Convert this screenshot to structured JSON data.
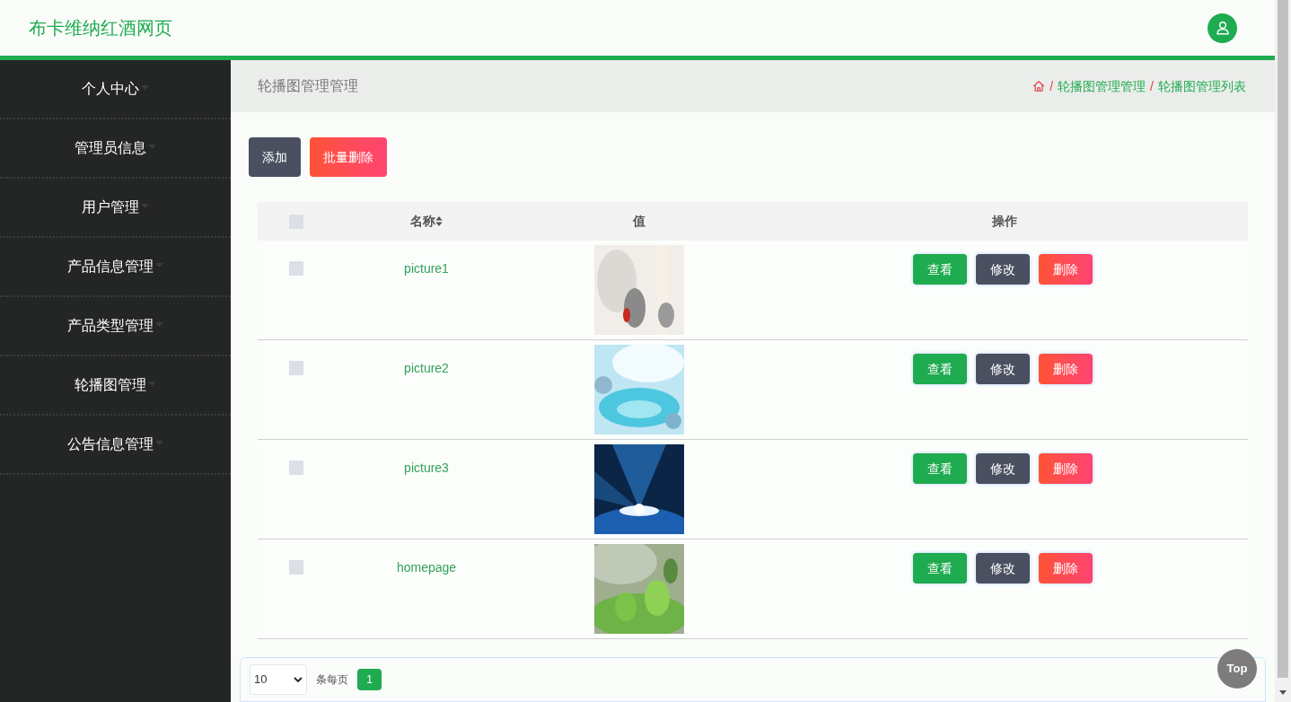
{
  "header": {
    "title": "布卡维纳红酒网页"
  },
  "sidebar": {
    "items": [
      {
        "label": "个人中心",
        "selected": false
      },
      {
        "label": "管理员信息",
        "selected": false
      },
      {
        "label": "用户管理",
        "selected": false
      },
      {
        "label": "产品信息管理",
        "selected": false
      },
      {
        "label": "产品类型管理",
        "selected": false
      },
      {
        "label": "轮播图管理",
        "selected": false
      },
      {
        "label": "公告信息管理",
        "selected": false
      }
    ]
  },
  "page_header": {
    "title": "轮播图管理管理",
    "breadcrumb": [
      {
        "separator": "/",
        "label": "轮播图管理管理"
      },
      {
        "separator": "/",
        "label": "轮播图管理列表"
      }
    ]
  },
  "toolbar": {
    "buttons": [
      {
        "label": "添加",
        "kind": "dark"
      },
      {
        "label": "批量删除",
        "kind": "danger"
      }
    ]
  },
  "table": {
    "select_all_checked": false,
    "columns": [
      "名称",
      "值",
      "操作"
    ],
    "rows": [
      {
        "checked": false,
        "name": "picture1",
        "actions": [
          {
            "label": "查看",
            "kind": "primary"
          },
          {
            "label": "修改",
            "kind": "dark"
          },
          {
            "label": "删除",
            "kind": "danger"
          }
        ]
      },
      {
        "checked": false,
        "name": "picture2",
        "actions": [
          {
            "label": "查看",
            "kind": "primary"
          },
          {
            "label": "修改",
            "kind": "dark"
          },
          {
            "label": "删除",
            "kind": "danger"
          }
        ]
      },
      {
        "checked": false,
        "name": "picture3",
        "actions": [
          {
            "label": "查看",
            "kind": "primary"
          },
          {
            "label": "修改",
            "kind": "dark"
          },
          {
            "label": "删除",
            "kind": "danger"
          }
        ]
      },
      {
        "checked": false,
        "name": "homepage",
        "actions": [
          {
            "label": "查看",
            "kind": "primary"
          },
          {
            "label": "修改",
            "kind": "dark"
          },
          {
            "label": "删除",
            "kind": "danger"
          }
        ]
      }
    ]
  },
  "pagination": {
    "page_size": "10",
    "page_size_label": "条每页",
    "pages": [
      {
        "label": "1",
        "selected": true
      }
    ]
  },
  "back_to_top": "Top"
}
